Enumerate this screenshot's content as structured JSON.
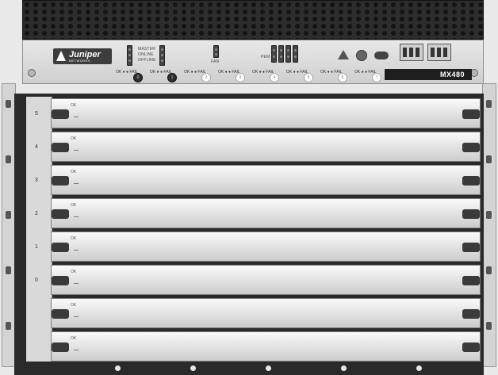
{
  "brand": {
    "logo_text": "Juniper",
    "logo_subtext": "NETWORKS"
  },
  "model": "MX480",
  "re_status_labels": [
    "MASTER",
    "ONLINE",
    "OFFLINE"
  ],
  "fan_label": "FAN",
  "pem_label": "PEM",
  "okfail_label": "OK ● ● FAIL",
  "pem_slots": [
    "0",
    "1",
    "2",
    "3",
    "4",
    "5",
    "6",
    "7"
  ],
  "card_slots": [
    "5",
    "4",
    "3",
    "2",
    "1",
    "0",
    "",
    ""
  ],
  "card_ok_label": "OK"
}
